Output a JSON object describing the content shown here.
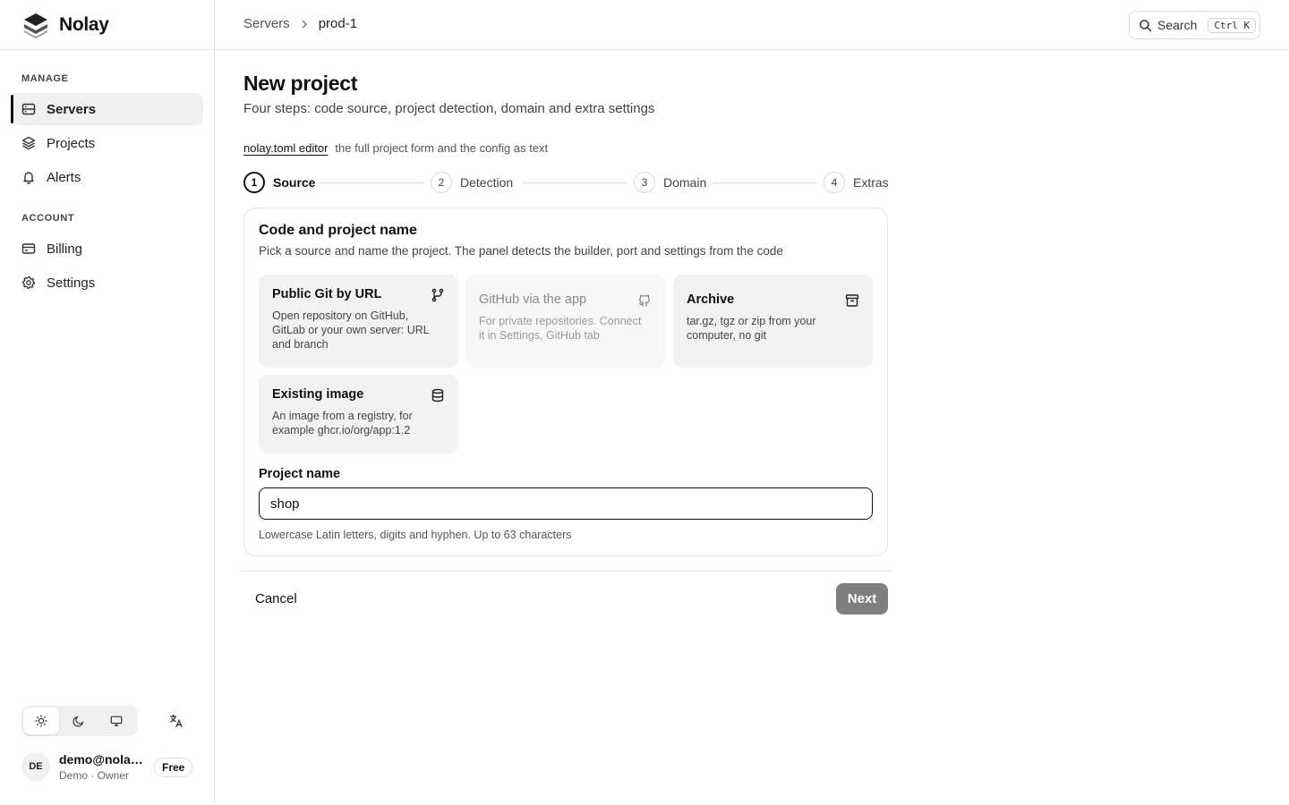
{
  "app": {
    "name": "Nolay"
  },
  "sidebar": {
    "sections": [
      {
        "title": "MANAGE",
        "items": [
          {
            "label": "Servers",
            "icon": "server-icon",
            "active": true
          },
          {
            "label": "Projects",
            "icon": "layers-icon",
            "active": false
          },
          {
            "label": "Alerts",
            "icon": "bell-icon",
            "active": false
          }
        ]
      },
      {
        "title": "ACCOUNT",
        "items": [
          {
            "label": "Billing",
            "icon": "credit-card-icon",
            "active": false
          },
          {
            "label": "Settings",
            "icon": "gear-icon",
            "active": false
          }
        ]
      }
    ],
    "theme": {
      "options": [
        "light",
        "dark",
        "system"
      ],
      "selected": "light"
    },
    "language_icon": "translate-icon",
    "user": {
      "initials": "DE",
      "email": "demo@nolay...",
      "role": "Demo · Owner",
      "plan": "Free"
    }
  },
  "topbar": {
    "breadcrumb": [
      "Servers",
      "prod-1"
    ],
    "search": {
      "label": "Search",
      "shortcut": "Ctrl K"
    }
  },
  "page": {
    "title": "New project",
    "subtitle": "Four steps: code source, project detection, domain and extra settings",
    "toml_link": "nolay.toml editor",
    "toml_desc": "the full project form and the config as text"
  },
  "steps": [
    {
      "number": "1",
      "label": "Source",
      "active": true
    },
    {
      "number": "2",
      "label": "Detection",
      "active": false
    },
    {
      "number": "3",
      "label": "Domain",
      "active": false
    },
    {
      "number": "4",
      "label": "Extras",
      "active": false
    }
  ],
  "card": {
    "title": "Code and project name",
    "description": "Pick a source and name the project. The panel detects the builder, port and settings from the code",
    "options": [
      {
        "title": "Public Git by URL",
        "description": "Open repository on GitHub, GitLab or your own server: URL and branch",
        "icon": "git-branch-icon",
        "disabled": false
      },
      {
        "title": "GitHub via the app",
        "description": "For private repositories. Connect it in Settings, GitHub tab",
        "icon": "github-icon",
        "disabled": true
      },
      {
        "title": "Archive",
        "description": "tar.gz, tgz or zip from your computer, no git",
        "icon": "archive-icon",
        "disabled": false
      },
      {
        "title": "Existing image",
        "description": "An image from a registry, for example ghcr.io/org/app:1.2",
        "icon": "database-icon",
        "disabled": false
      }
    ],
    "name_field": {
      "label": "Project name",
      "value": "shop",
      "hint": "Lowercase Latin letters, digits and hyphen. Up to 63 characters"
    }
  },
  "actions": {
    "cancel": "Cancel",
    "next": "Next"
  },
  "colors": {
    "accent": "#111111",
    "next_button_bg": "#7f7f7f",
    "option_bg": "#f2f2f2"
  }
}
